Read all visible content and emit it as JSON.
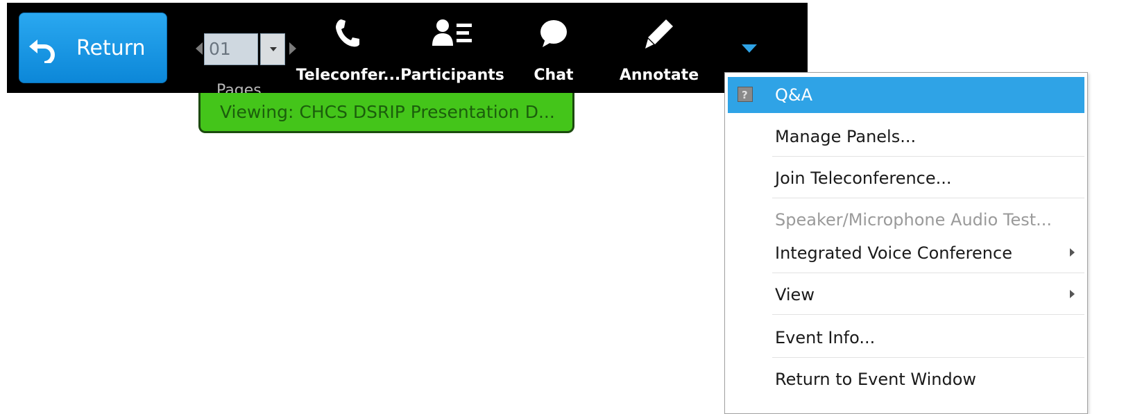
{
  "toolbar": {
    "return_label": "Return",
    "pager": {
      "current_page": "01",
      "label": "Pages"
    },
    "tools": [
      {
        "label": "Teleconfer...",
        "icon": "phone-icon"
      },
      {
        "label": "Participants",
        "icon": "participants-icon"
      },
      {
        "label": "Chat",
        "icon": "chat-bubble-icon"
      },
      {
        "label": "Annotate",
        "icon": "pencil-icon"
      }
    ],
    "overflow_icon": "caret-down-icon"
  },
  "banner": {
    "text": "Viewing: CHCS DSRIP Presentation D..."
  },
  "menu": {
    "items": [
      {
        "label": "Q&A",
        "state": "highlighted",
        "icon": "qa-icon"
      },
      {
        "label": "Manage Panels..."
      },
      {
        "label": "Join Teleconference..."
      },
      {
        "label": "Speaker/Microphone Audio Test...",
        "state": "disabled"
      },
      {
        "label": "Integrated Voice Conference",
        "submenu": true
      },
      {
        "label": "View",
        "submenu": true
      },
      {
        "label": "Event Info..."
      },
      {
        "label": "Return to Event Window"
      }
    ]
  },
  "colors": {
    "toolbar_bg": "#000000",
    "return_button": "#1a9ae6",
    "banner_bg": "#44c51a",
    "menu_highlight": "#2fa3e6",
    "disabled_text": "#9a9a9a"
  }
}
